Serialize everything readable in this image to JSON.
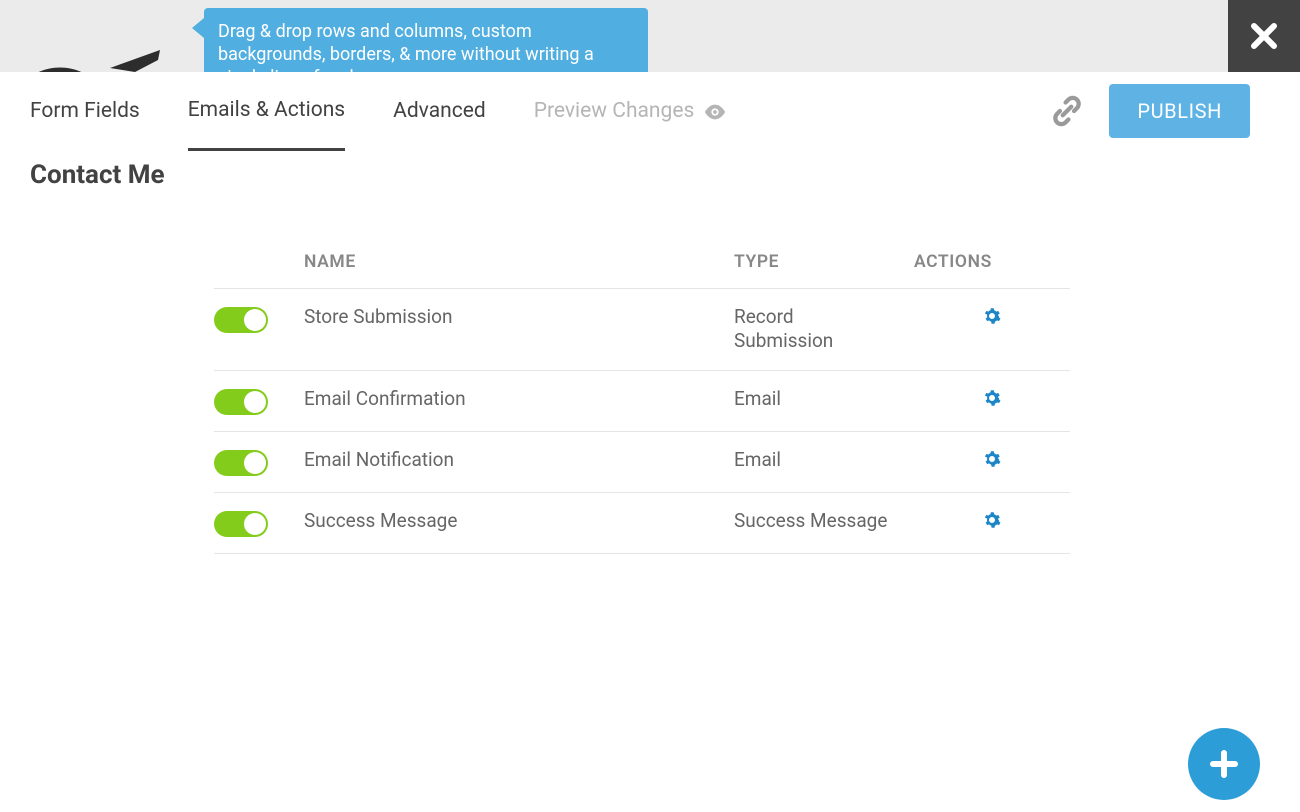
{
  "tooltip_text": "Drag & drop rows and columns, custom backgrounds, borders, & more without writing a single line of code.",
  "tabs": {
    "form_fields": "Form Fields",
    "emails_actions": "Emails & Actions",
    "advanced": "Advanced",
    "preview": "Preview Changes"
  },
  "publish_label": "PUBLISH",
  "page_title": "Contact Me",
  "table": {
    "headers": {
      "name": "NAME",
      "type": "TYPE",
      "actions": "ACTIONS"
    },
    "rows": [
      {
        "enabled": true,
        "name": "Store Submission",
        "type": "Record Submission"
      },
      {
        "enabled": true,
        "name": "Email Confirmation",
        "type": "Email"
      },
      {
        "enabled": true,
        "name": "Email Notification",
        "type": "Email"
      },
      {
        "enabled": true,
        "name": "Success Message",
        "type": "Success Message"
      }
    ]
  }
}
